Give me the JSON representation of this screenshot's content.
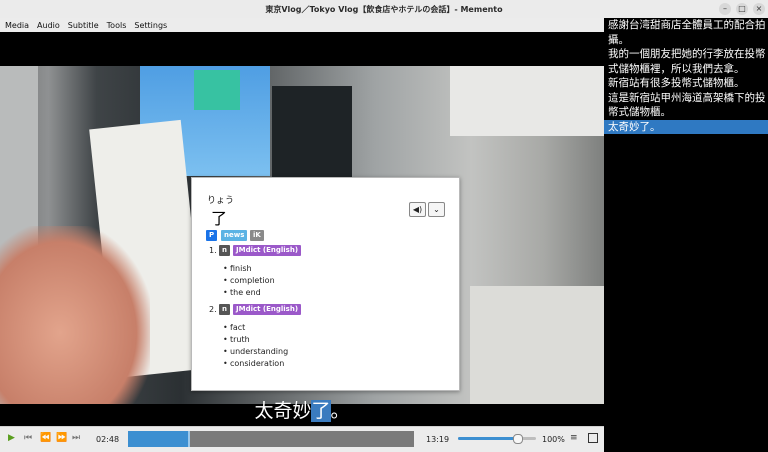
{
  "window": {
    "title": "東京Vlog／Tokyo Vlog【飲食店やホテルの会話】- Memento",
    "minimize": "–",
    "maximize": "□",
    "close": "×"
  },
  "menu": {
    "items": [
      "Media",
      "Audio",
      "Subtitle",
      "Tools",
      "Settings"
    ]
  },
  "popup": {
    "reading": "りょう",
    "term": "了",
    "audio_icon": "◀)",
    "menu_icon": "⌄",
    "tags": {
      "p": "P",
      "news": "news",
      "ik": "iK"
    },
    "senses": [
      {
        "num": "1.",
        "pos": "n",
        "dict": "JMdict (English)",
        "glosses": [
          "finish",
          "completion",
          "the end"
        ]
      },
      {
        "num": "2.",
        "pos": "n",
        "dict": "JMdict (English)",
        "glosses": [
          "fact",
          "truth",
          "understanding",
          "consideration"
        ]
      }
    ]
  },
  "subtitle": {
    "before": "太奇妙",
    "highlight": "了",
    "after": "。"
  },
  "controls": {
    "play_icon": "▶",
    "prev_icon": "⏮",
    "rewind_icon": "⏪",
    "forward_icon": "⏩",
    "next_icon": "⏭",
    "time_current": "02:48",
    "time_total": "13:19",
    "progress_fraction": 0.21,
    "volume_fraction": 0.75,
    "volume_percent": "100%",
    "list_icon": "≡"
  },
  "subtitle_list": {
    "lines": [
      "感謝台湾甜商店全體員工的配合拍攝。",
      "我的一個朋友把她的行李放在投幣式儲物櫃裡，所以我們去拿。",
      "新宿站有很多投幣式儲物櫃。",
      "這是新宿站甲州海道高架橋下的投幣式儲物櫃。",
      "太奇妙了。"
    ],
    "active_index": 4
  },
  "colors": {
    "accent": "#2f79c2",
    "dict_tag": "#9b59c9",
    "popular_tag": "#1a73e8",
    "news_tag": "#5bb3e4"
  }
}
